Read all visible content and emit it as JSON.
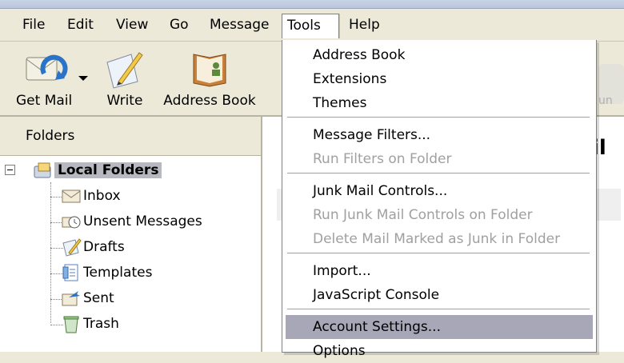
{
  "menubar": {
    "items": [
      {
        "label": "File"
      },
      {
        "label": "Edit"
      },
      {
        "label": "View"
      },
      {
        "label": "Go"
      },
      {
        "label": "Message"
      },
      {
        "label": "Tools"
      },
      {
        "label": "Help"
      }
    ]
  },
  "toolbar": {
    "get_mail": "Get Mail",
    "write": "Write",
    "address_book": "Address Book",
    "junk_partial": "un"
  },
  "folder_pane": {
    "header": "Folders",
    "root": "Local Folders",
    "folders": [
      "Inbox",
      "Unsent Messages",
      "Drafts",
      "Templates",
      "Sent",
      "Trash"
    ]
  },
  "right_pane": {
    "peek_text": "il"
  },
  "tools_menu": {
    "groups": [
      [
        "Address Book",
        "Extensions",
        "Themes"
      ],
      [
        "Message Filters...",
        "Run Filters on Folder"
      ],
      [
        "Junk Mail Controls...",
        "Run Junk Mail Controls on Folder",
        "Delete Mail Marked as Junk in Folder"
      ],
      [
        "Import...",
        "JavaScript Console"
      ],
      [
        "Account Settings...",
        "Options"
      ]
    ],
    "disabled": [
      "Run Filters on Folder",
      "Run Junk Mail Controls on Folder",
      "Delete Mail Marked as Junk in Folder"
    ],
    "highlighted": "Account Settings..."
  },
  "colors": {
    "chrome": "#ece9d8",
    "menu_highlight": "#a7a7b8",
    "disabled_text": "#a0a0a0"
  }
}
